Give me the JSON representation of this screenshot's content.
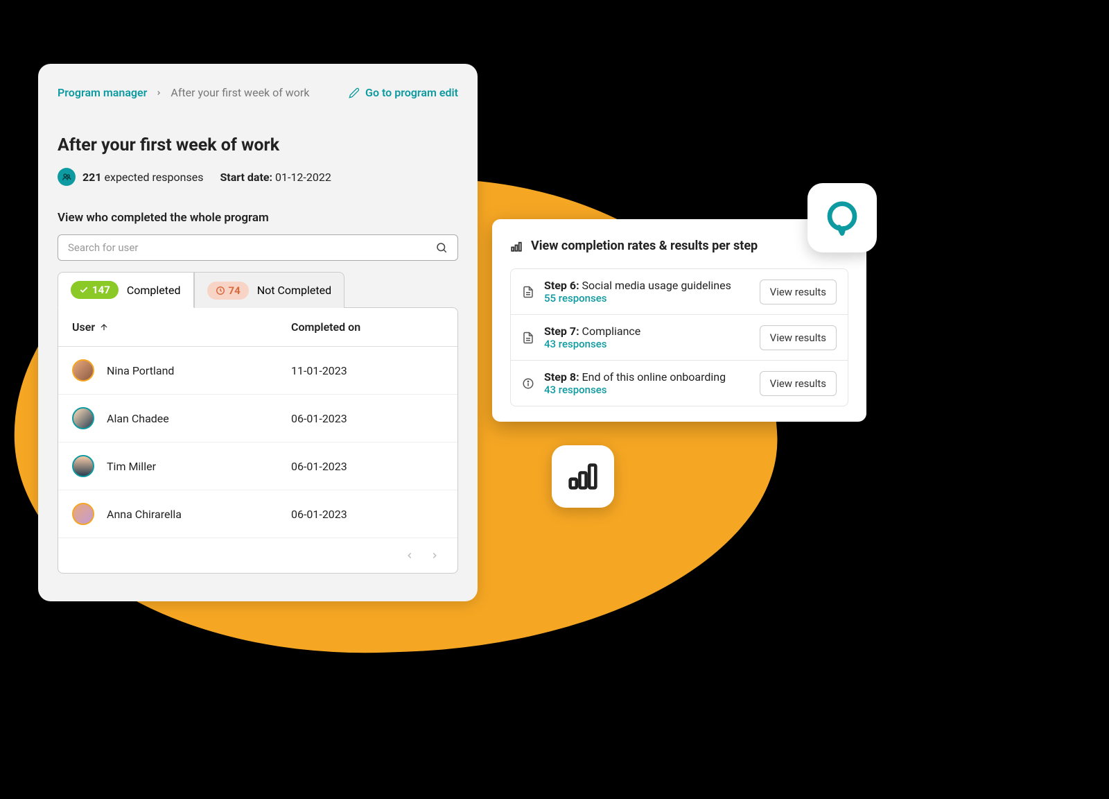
{
  "breadcrumb": {
    "root": "Program manager",
    "current": "After your first week of work"
  },
  "edit_link": "Go to program edit",
  "page_title": "After your first week of work",
  "meta": {
    "responses_count": "221",
    "responses_label": "expected responses",
    "start_date_label": "Start date:",
    "start_date": "01-12-2022"
  },
  "subheading": "View who completed the whole program",
  "search": {
    "placeholder": "Search for user"
  },
  "tabs": {
    "completed": {
      "count": "147",
      "label": "Completed"
    },
    "not_completed": {
      "count": "74",
      "label": "Not Completed"
    }
  },
  "table": {
    "header_user": "User",
    "header_completed_on": "Completed on",
    "rows": [
      {
        "name": "Nina Portland",
        "date": "11-01-2023"
      },
      {
        "name": "Alan Chadee",
        "date": "06-01-2023"
      },
      {
        "name": "Tim Miller",
        "date": "06-01-2023"
      },
      {
        "name": "Anna Chirarella",
        "date": "06-01-2023"
      }
    ]
  },
  "steps_card": {
    "title": "View completion rates & results per step",
    "view_results_label": "View results",
    "steps": [
      {
        "label_prefix": "Step 6:",
        "label": "Social media usage guidelines",
        "responses": "55 responses"
      },
      {
        "label_prefix": "Step 7:",
        "label": "Compliance",
        "responses": "43 responses"
      },
      {
        "label_prefix": "Step 8:",
        "label": "End of this online onboarding",
        "responses": "43 responses"
      }
    ]
  },
  "colors": {
    "accent_teal": "#0d9aa0",
    "accent_orange": "#F5A623",
    "pill_green": "#8ac926",
    "pill_orange_bg": "#f8d4c6",
    "pill_orange_fg": "#d96a3d"
  }
}
